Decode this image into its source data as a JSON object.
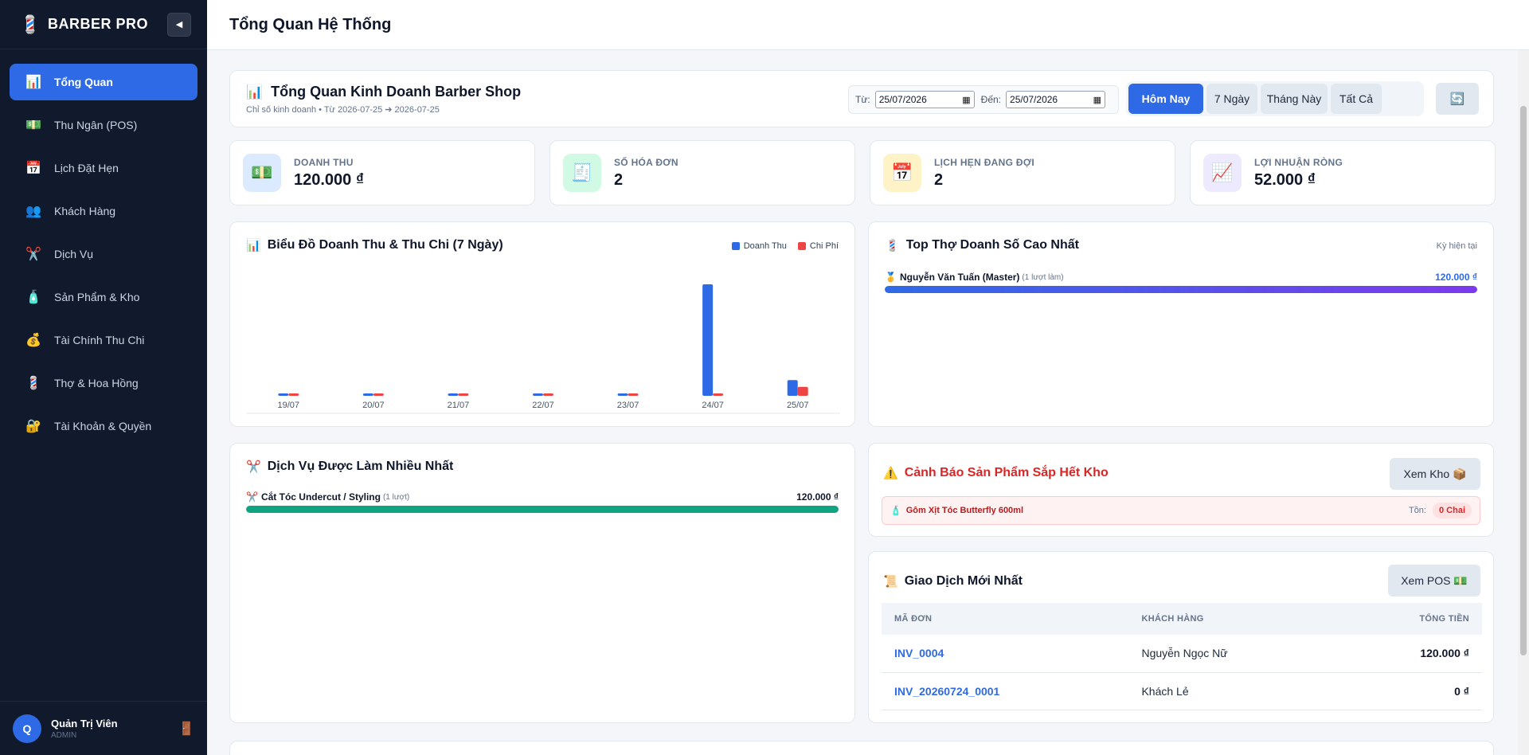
{
  "app": {
    "brand": "BARBER PRO",
    "brand_icon": "barber-pole-icon",
    "collapse_glyph": "◀"
  },
  "sidebar": {
    "items": [
      {
        "label": "Tổng Quan",
        "icon": "📊",
        "active": true
      },
      {
        "label": "Thu Ngân (POS)",
        "icon": "💵"
      },
      {
        "label": "Lịch Đặt Hẹn",
        "icon": "📅"
      },
      {
        "label": "Khách Hàng",
        "icon": "👥"
      },
      {
        "label": "Dịch Vụ",
        "icon": "✂️"
      },
      {
        "label": "Sản Phẩm & Kho",
        "icon": "🧴"
      },
      {
        "label": "Tài Chính Thu Chi",
        "icon": "💰"
      },
      {
        "label": "Thợ & Hoa Hồng",
        "icon": "💈"
      },
      {
        "label": "Tài Khoản & Quyền",
        "icon": "🔐"
      }
    ],
    "user": {
      "initial": "Q",
      "name": "Quản Trị Viên",
      "role": "ADMIN"
    }
  },
  "header": {
    "title": "Tổng Quan Hệ Thống"
  },
  "overview": {
    "title": "Tổng Quan Kinh Doanh Barber Shop",
    "subtitle": "Chỉ số kinh doanh • Từ 2026-07-25 ➔ 2026-07-25",
    "from_label": "Từ:",
    "from_value": "25/07/2026",
    "to_label": "Đến:",
    "to_value": "25/07/2026",
    "ranges": [
      "Hôm Nay",
      "7 Ngày",
      "Tháng Này",
      "Tất Cả"
    ],
    "active_range": "Hôm Nay"
  },
  "stats": [
    {
      "label": "DOANH THU",
      "value": "120.000 ₫",
      "icon": "💵",
      "bg": "#dbeafe"
    },
    {
      "label": "SỐ HÓA ĐƠN",
      "value": "2",
      "icon": "🧾",
      "bg": "#d1fae5"
    },
    {
      "label": "LỊCH HẸN ĐANG ĐỢI",
      "value": "2",
      "icon": "📅",
      "bg": "#fef3c7"
    },
    {
      "label": "LỢI NHUẬN RÒNG",
      "value": "52.000 ₫",
      "icon": "📈",
      "bg": "#ede9fe"
    }
  ],
  "chart_section": {
    "title": "Biểu Đồ Doanh Thu & Thu Chi (7 Ngày)"
  },
  "chart_data": {
    "type": "bar",
    "categories": [
      "19/07",
      "20/07",
      "21/07",
      "22/07",
      "23/07",
      "24/07",
      "25/07"
    ],
    "series": [
      {
        "name": "Doanh Thu",
        "color": "#2f6ae6",
        "values": [
          0,
          0,
          0,
          0,
          0,
          850000,
          120000
        ]
      },
      {
        "name": "Chi Phí",
        "color": "#ef4444",
        "values": [
          0,
          0,
          0,
          0,
          0,
          0,
          68000
        ]
      }
    ],
    "ylim": [
      0,
      850000
    ],
    "grid": false,
    "legend": "top-right"
  },
  "top_barbers": {
    "title": "Top Thợ Doanh Số Cao Nhất",
    "period": "Kỳ hiện tại",
    "items": [
      {
        "medal": "🥇",
        "name": "Nguyễn Văn Tuấn (Master)",
        "note": "(1 lượt làm)",
        "value": "120.000 ₫",
        "ratio": 1
      }
    ]
  },
  "top_services": {
    "title": "Dịch Vụ Được Làm Nhiều Nhất",
    "items": [
      {
        "icon": "✂️",
        "name": "Cắt Tóc Undercut / Styling",
        "note": "(1 lượt)",
        "value": "120.000 ₫",
        "ratio": 1
      }
    ]
  },
  "stock_alert": {
    "title": "Cảnh Báo Sản Phẩm Sắp Hết Kho",
    "button": "Xem Kho 📦",
    "items": [
      {
        "name": "Gôm Xịt Tóc Butterfly 600ml",
        "stock_label": "Tồn:",
        "stock": "0 Chai"
      }
    ]
  },
  "transactions": {
    "title": "Giao Dịch Mới Nhất",
    "button": "Xem POS 💵",
    "columns": [
      "MÃ ĐƠN",
      "KHÁCH HÀNG",
      "TỔNG TIỀN"
    ],
    "rows": [
      {
        "code": "INV_0004",
        "customer": "Nguyễn Ngọc Nữ",
        "total": "120.000 ₫"
      },
      {
        "code": "INV_20260724_0001",
        "customer": "Khách Lẻ",
        "total": "0 ₫"
      }
    ]
  }
}
